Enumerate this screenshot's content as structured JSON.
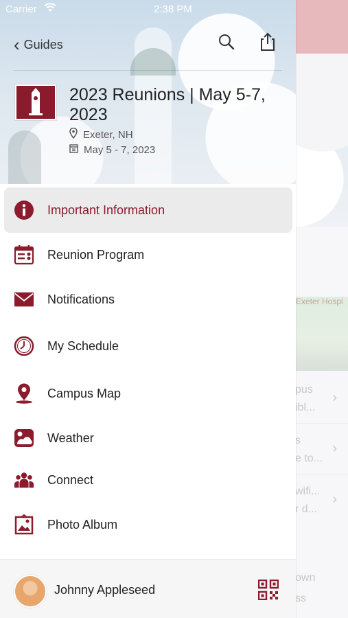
{
  "status_bar": {
    "carrier": "Carrier",
    "time": "2:38 PM"
  },
  "nav": {
    "back_label": "Guides"
  },
  "guide": {
    "title": "2023 Reunions | May 5-7, 2023",
    "location": "Exeter, NH",
    "dates": "May 5 - 7, 2023"
  },
  "menu": {
    "items": [
      {
        "label": "Important Information",
        "icon": "info-icon",
        "active": true
      },
      {
        "label": "Reunion Program",
        "icon": "program-icon"
      },
      {
        "label": "Notifications",
        "icon": "envelope-icon"
      },
      {
        "label": "My Schedule",
        "icon": "clock-icon"
      },
      {
        "label": "Campus Map",
        "icon": "map-pin-icon"
      },
      {
        "label": "Weather",
        "icon": "weather-icon"
      },
      {
        "label": "Connect",
        "icon": "people-icon"
      },
      {
        "label": "Photo Album",
        "icon": "photo-icon"
      }
    ]
  },
  "user": {
    "name": "Johnny Appleseed"
  },
  "peek": {
    "map_label": "Exeter Hospi",
    "rows": [
      {
        "line1": "pus",
        "line2": "ibl..."
      },
      {
        "line1": "s",
        "line2": "e to..."
      },
      {
        "line1": "wifi...",
        "line2": "r d..."
      },
      {
        "line1": "own",
        "line2": "ss"
      }
    ]
  },
  "colors": {
    "accent": "#8b1b2d",
    "active_bg": "#ebebeb"
  }
}
